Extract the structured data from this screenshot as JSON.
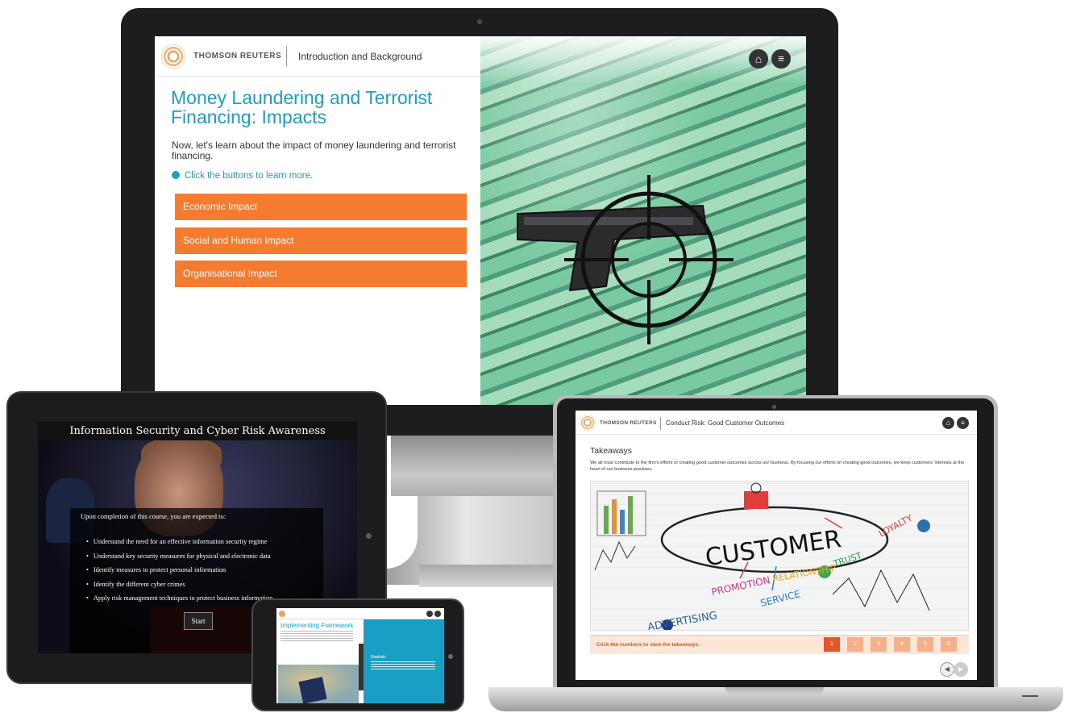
{
  "monitor": {
    "brand": "THOMSON REUTERS",
    "section": "Introduction and Background",
    "title": "Money Laundering and Terrorist Financing: Impacts",
    "intro": "Now, let's learn about the impact of money laundering and terrorist financing.",
    "hint": "Click the buttons to learn more.",
    "buttons": [
      "Economic Impact",
      "Social and Human Impact",
      "Organisational Impact"
    ],
    "icons": {
      "home": "home-icon",
      "menu": "menu-icon"
    }
  },
  "tablet": {
    "title": "Information Security and Cyber Risk Awareness",
    "lead": "Upon completion of this course, you are expected to:",
    "objectives": [
      "Understand the need for an effective information security regime",
      "Understand key security measures for physical and electronic data",
      "Identify measures to protect personal information",
      "Identify the different cyber crimes",
      "Apply risk management techniques to protect business information"
    ],
    "start_label": "Start"
  },
  "phone": {
    "title": "Implementing Framework",
    "panel_title": "Realistic"
  },
  "laptop": {
    "brand": "THOMSON REUTERS",
    "section": "Conduct Risk: Good Customer Outcomes",
    "title": "Takeaways",
    "text": "We all must contribute to the firm's efforts to creating good customer outcomes across our business. By focusing our efforts on creating good outcomes, we keep customers' interests at the heart of our business practises.",
    "image_words": {
      "customer": "CUSTOMER",
      "promotion": "PROMOTION",
      "relationship": "RELATIONSHIP",
      "trust": "TRUST",
      "loyalty": "LOYALTY",
      "service": "SERVICE",
      "advertising": "ADVERTISING"
    },
    "instruction": "Click the numbers to view the takeaways.",
    "numbers": [
      "1",
      "2",
      "3",
      "4",
      "5",
      "6"
    ],
    "active_number": "1",
    "colors": {
      "accent": "#e2562a",
      "tile": "#f5b089"
    }
  },
  "colors": {
    "teal": "#1a9fc4",
    "orange": "#f47b30"
  }
}
